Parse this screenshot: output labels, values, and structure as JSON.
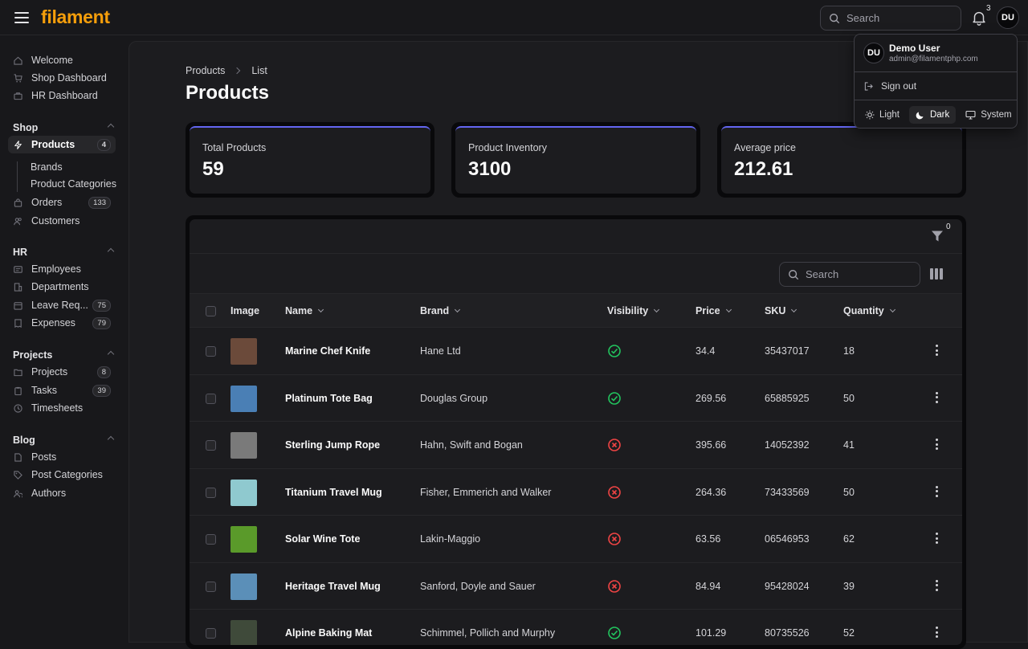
{
  "app": {
    "logo": "filament"
  },
  "topbar": {
    "search_placeholder": "Search",
    "notifications_count": "3",
    "avatar_initials": "DU"
  },
  "sidebar": {
    "top_items": [
      {
        "label": "Welcome",
        "icon": "home-icon"
      },
      {
        "label": "Shop Dashboard",
        "icon": "cart-icon"
      },
      {
        "label": "HR Dashboard",
        "icon": "briefcase-icon"
      }
    ],
    "groups": {
      "shop": {
        "label": "Shop",
        "products": {
          "label": "Products",
          "badge": "4"
        },
        "sub": [
          "Brands",
          "Product Categories"
        ],
        "orders": {
          "label": "Orders",
          "badge": "133"
        },
        "customers": {
          "label": "Customers"
        }
      },
      "hr": {
        "label": "HR",
        "items": [
          {
            "label": "Employees",
            "badge": ""
          },
          {
            "label": "Departments",
            "badge": ""
          },
          {
            "label": "Leave Req...",
            "badge": "75"
          },
          {
            "label": "Expenses",
            "badge": "79"
          }
        ]
      },
      "projects": {
        "label": "Projects",
        "items": [
          {
            "label": "Projects",
            "badge": "8"
          },
          {
            "label": "Tasks",
            "badge": "39"
          },
          {
            "label": "Timesheets",
            "badge": ""
          }
        ]
      },
      "blog": {
        "label": "Blog",
        "items": [
          {
            "label": "Posts"
          },
          {
            "label": "Post Categories"
          },
          {
            "label": "Authors"
          }
        ]
      }
    }
  },
  "page": {
    "breadcrumb": [
      "Products",
      "List"
    ],
    "title": "Products",
    "stats": [
      {
        "label": "Total Products",
        "value": "59"
      },
      {
        "label": "Product Inventory",
        "value": "3100"
      },
      {
        "label": "Average price",
        "value": "212.61"
      }
    ]
  },
  "table": {
    "filter_count": "0",
    "search_placeholder": "Search",
    "columns": [
      "Image",
      "Name",
      "Brand",
      "Visibility",
      "Price",
      "SKU",
      "Quantity"
    ],
    "rows": [
      {
        "name": "Marine Chef Knife",
        "brand": "Hane Ltd",
        "visible": true,
        "price": "34.4",
        "sku": "35437017",
        "qty": "18",
        "thumb": "#6b4a3a"
      },
      {
        "name": "Platinum Tote Bag",
        "brand": "Douglas Group",
        "visible": true,
        "price": "269.56",
        "sku": "65885925",
        "qty": "50",
        "thumb": "#4a7fb5"
      },
      {
        "name": "Sterling Jump Rope",
        "brand": "Hahn, Swift and Bogan",
        "visible": false,
        "price": "395.66",
        "sku": "14052392",
        "qty": "41",
        "thumb": "#7a7a7a"
      },
      {
        "name": "Titanium Travel Mug",
        "brand": "Fisher, Emmerich and Walker",
        "visible": false,
        "price": "264.36",
        "sku": "73433569",
        "qty": "50",
        "thumb": "#8fc9cf"
      },
      {
        "name": "Solar Wine Tote",
        "brand": "Lakin-Maggio",
        "visible": false,
        "price": "63.56",
        "sku": "06546953",
        "qty": "62",
        "thumb": "#5a9a2a"
      },
      {
        "name": "Heritage Travel Mug",
        "brand": "Sanford, Doyle and Sauer",
        "visible": false,
        "price": "84.94",
        "sku": "95428024",
        "qty": "39",
        "thumb": "#5b8fb8"
      },
      {
        "name": "Alpine Baking Mat",
        "brand": "Schimmel, Pollich and Murphy",
        "visible": true,
        "price": "101.29",
        "sku": "80735526",
        "qty": "52",
        "thumb": "#3f4a3a"
      }
    ]
  },
  "user_menu": {
    "initials": "DU",
    "name": "Demo User",
    "email": "admin@filamentphp.com",
    "sign_out": "Sign out",
    "themes": [
      {
        "label": "Light",
        "active": false
      },
      {
        "label": "Dark",
        "active": true
      },
      {
        "label": "System",
        "active": false
      }
    ]
  },
  "colors": {
    "accent": "#f59e0b",
    "primary": "#6366f1",
    "success": "#22c55e",
    "danger": "#ef4444"
  }
}
